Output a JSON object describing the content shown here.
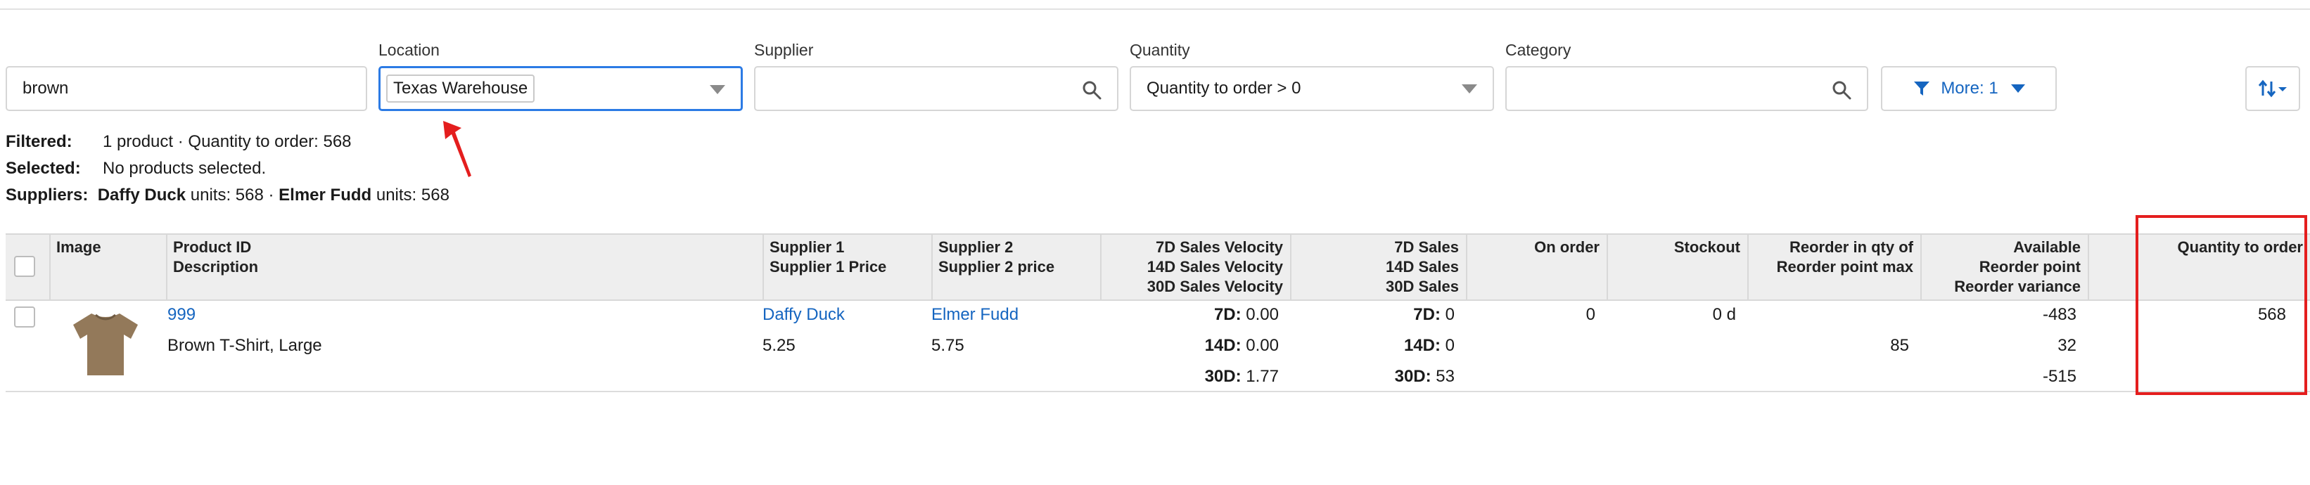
{
  "filters": {
    "search_value": "brown",
    "location": {
      "label": "Location",
      "value": "Texas Warehouse"
    },
    "supplier": {
      "label": "Supplier",
      "value": ""
    },
    "quantity": {
      "label": "Quantity",
      "value": "Quantity to order > 0"
    },
    "category": {
      "label": "Category",
      "value": ""
    },
    "more_button": "More: 1"
  },
  "summary": {
    "filtered_label": "Filtered:",
    "filtered_text": "1 product · Quantity to order: 568",
    "selected_label": "Selected:",
    "selected_text": "No products selected.",
    "suppliers_label": "Suppliers:",
    "supplier1_name": "Daffy Duck",
    "supplier1_units": "units: 568 ·",
    "supplier2_name": "Elmer Fudd",
    "supplier2_units": "units: 568"
  },
  "columns": {
    "image": "Image",
    "product_id": "Product ID",
    "description": "Description",
    "supplier1": "Supplier 1",
    "supplier1_price": "Supplier 1 Price",
    "supplier2": "Supplier 2",
    "supplier2_price": "Supplier 2 price",
    "vel7": "7D Sales Velocity",
    "vel14": "14D Sales Velocity",
    "vel30": "30D Sales Velocity",
    "sales7": "7D Sales",
    "sales14": "14D Sales",
    "sales30": "30D Sales",
    "on_order": "On order",
    "stockout": "Stockout",
    "reorder_qty": "Reorder in qty of",
    "reorder_max": "Reorder point max",
    "available": "Available",
    "reorder_point": "Reorder point",
    "reorder_variance": "Reorder variance",
    "qty_to_order": "Quantity to order"
  },
  "row": {
    "product_id": "999",
    "description": "Brown T-Shirt, Large",
    "supplier1": "Daffy Duck",
    "supplier1_price": "5.25",
    "supplier2": "Elmer Fudd",
    "supplier2_price": "5.75",
    "vel7_label": "7D:",
    "vel7": "0.00",
    "vel14_label": "14D:",
    "vel14": "0.00",
    "vel30_label": "30D:",
    "vel30": "1.77",
    "sales7_label": "7D:",
    "sales7": "0",
    "sales14_label": "14D:",
    "sales14": "0",
    "sales30_label": "30D:",
    "sales30": "53",
    "on_order": "0",
    "stockout": "0 d",
    "reorder_max": "85",
    "available": "-483",
    "reorder_point": "32",
    "reorder_variance": "-515",
    "qty_to_order": "568"
  },
  "colors": {
    "accent": "#1565c0",
    "focus_border": "#2c7be5",
    "annotation_red": "#e41e1e"
  }
}
